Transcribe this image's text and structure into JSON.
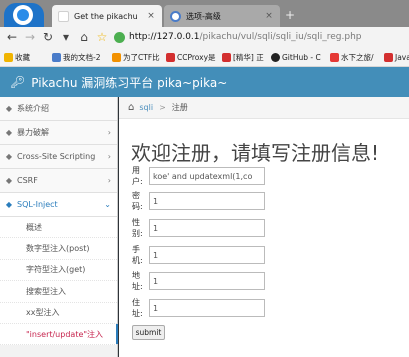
{
  "browser": {
    "tabs": [
      {
        "label": "Get the pikachu",
        "close": "×"
      },
      {
        "label": "选项-高级",
        "close": "×"
      }
    ],
    "new_tab": "+",
    "nav": {
      "back": "←",
      "forward": "→",
      "reload": "↻",
      "home": "⌂"
    },
    "url_host": "http://127.0.0.1",
    "url_path": "/pikachu/vul/sqli/sqli_iu/sqli_reg.php",
    "bookmarks": [
      {
        "label": "收藏",
        "color": "#f0b400"
      },
      {
        "label": "我的文档-2",
        "color": "#4a7cc9"
      },
      {
        "label": "为了CTF比",
        "color": "#f29100"
      },
      {
        "label": "CCProxy是",
        "color": "#d32f2f"
      },
      {
        "label": "[精华] 正",
        "color": "#d32f2f"
      },
      {
        "label": "GitHub - C",
        "color": "#222222"
      },
      {
        "label": "水下之旅/",
        "color": "#e53935"
      },
      {
        "label": "Java",
        "color": "#d32f2f"
      }
    ]
  },
  "header": {
    "title": "Pikachu 漏洞练习平台 pika~pika~",
    "icon": "key-icon"
  },
  "sidebar": {
    "items_top": [
      {
        "label": "系统介绍",
        "icon": "tag-icon"
      },
      {
        "label": "暴力破解",
        "icon": "tag-icon",
        "chevron": "›"
      },
      {
        "label": "Cross-Site Scripting",
        "icon": "tag-icon",
        "chevron": "›"
      },
      {
        "label": "CSRF",
        "icon": "tag-icon",
        "chevron": "›"
      },
      {
        "label": "SQL-Inject",
        "icon": "tag-icon",
        "chevron": "⌄"
      }
    ],
    "sub_items": [
      {
        "label": "概述"
      },
      {
        "label": "数字型注入(post)"
      },
      {
        "label": "字符型注入(get)"
      },
      {
        "label": "搜索型注入"
      },
      {
        "label": "xx型注入"
      },
      {
        "label": "\"insert/update\"注入"
      }
    ]
  },
  "breadcrumb": {
    "home_icon": "home-icon",
    "link": "sqli",
    "sep": ">",
    "current": "注册"
  },
  "form": {
    "title": "欢迎注册，请填写注册信息!",
    "fields": [
      {
        "label": "用户:",
        "value": "koe' and updatexml(1,co"
      },
      {
        "label": "密码:",
        "value": "1"
      },
      {
        "label": "性别:",
        "value": "1"
      },
      {
        "label": "手机:",
        "value": "1"
      },
      {
        "label": "地址:",
        "value": "1"
      },
      {
        "label": "住址:",
        "value": "1"
      }
    ],
    "submit": "submit"
  },
  "colors": {
    "header": "#438eb9",
    "accent": "#2b7dbc",
    "active_sub": "#c7254e"
  }
}
